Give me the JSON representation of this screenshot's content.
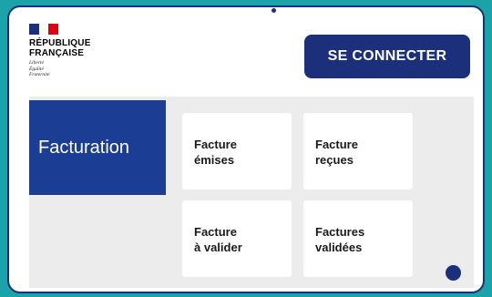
{
  "header": {
    "logo": {
      "name_line1": "RÉPUBLIQUE",
      "name_line2": "FRANÇAISE",
      "motto_line1": "Liberté",
      "motto_line2": "Égalité",
      "motto_line3": "Fraternité"
    },
    "connect_button_label": "SE CONNECTER"
  },
  "sidebar": {
    "active_item_label": "Facturation"
  },
  "tiles": [
    {
      "line1": "Facture",
      "line2": "émises"
    },
    {
      "line1": "Facture",
      "line2": "reçues"
    },
    {
      "line1": "Facture",
      "line2": "à valider"
    },
    {
      "line1": "Factures",
      "line2": "validées"
    }
  ],
  "colors": {
    "background": "#1aa3a8",
    "primary": "#1b2f7a",
    "nav_active": "#1b3e94",
    "flag_red": "#e1000f",
    "panel": "#ececec"
  }
}
